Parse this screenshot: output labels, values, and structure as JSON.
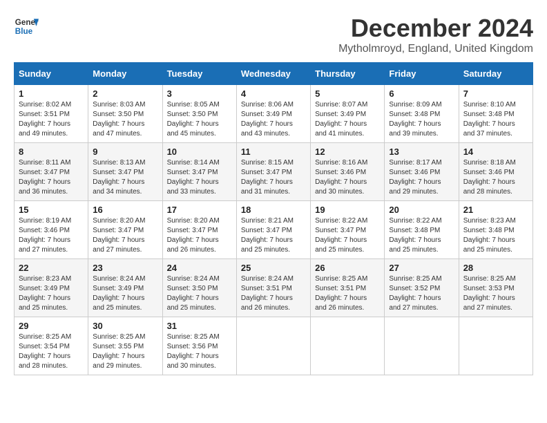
{
  "logo": {
    "line1": "General",
    "line2": "Blue"
  },
  "title": {
    "month": "December 2024",
    "location": "Mytholmroyd, England, United Kingdom"
  },
  "weekdays": [
    "Sunday",
    "Monday",
    "Tuesday",
    "Wednesday",
    "Thursday",
    "Friday",
    "Saturday"
  ],
  "weeks": [
    [
      {
        "day": "1",
        "sunrise": "Sunrise: 8:02 AM",
        "sunset": "Sunset: 3:51 PM",
        "daylight": "Daylight: 7 hours and 49 minutes."
      },
      {
        "day": "2",
        "sunrise": "Sunrise: 8:03 AM",
        "sunset": "Sunset: 3:50 PM",
        "daylight": "Daylight: 7 hours and 47 minutes."
      },
      {
        "day": "3",
        "sunrise": "Sunrise: 8:05 AM",
        "sunset": "Sunset: 3:50 PM",
        "daylight": "Daylight: 7 hours and 45 minutes."
      },
      {
        "day": "4",
        "sunrise": "Sunrise: 8:06 AM",
        "sunset": "Sunset: 3:49 PM",
        "daylight": "Daylight: 7 hours and 43 minutes."
      },
      {
        "day": "5",
        "sunrise": "Sunrise: 8:07 AM",
        "sunset": "Sunset: 3:49 PM",
        "daylight": "Daylight: 7 hours and 41 minutes."
      },
      {
        "day": "6",
        "sunrise": "Sunrise: 8:09 AM",
        "sunset": "Sunset: 3:48 PM",
        "daylight": "Daylight: 7 hours and 39 minutes."
      },
      {
        "day": "7",
        "sunrise": "Sunrise: 8:10 AM",
        "sunset": "Sunset: 3:48 PM",
        "daylight": "Daylight: 7 hours and 37 minutes."
      }
    ],
    [
      {
        "day": "8",
        "sunrise": "Sunrise: 8:11 AM",
        "sunset": "Sunset: 3:47 PM",
        "daylight": "Daylight: 7 hours and 36 minutes."
      },
      {
        "day": "9",
        "sunrise": "Sunrise: 8:13 AM",
        "sunset": "Sunset: 3:47 PM",
        "daylight": "Daylight: 7 hours and 34 minutes."
      },
      {
        "day": "10",
        "sunrise": "Sunrise: 8:14 AM",
        "sunset": "Sunset: 3:47 PM",
        "daylight": "Daylight: 7 hours and 33 minutes."
      },
      {
        "day": "11",
        "sunrise": "Sunrise: 8:15 AM",
        "sunset": "Sunset: 3:47 PM",
        "daylight": "Daylight: 7 hours and 31 minutes."
      },
      {
        "day": "12",
        "sunrise": "Sunrise: 8:16 AM",
        "sunset": "Sunset: 3:46 PM",
        "daylight": "Daylight: 7 hours and 30 minutes."
      },
      {
        "day": "13",
        "sunrise": "Sunrise: 8:17 AM",
        "sunset": "Sunset: 3:46 PM",
        "daylight": "Daylight: 7 hours and 29 minutes."
      },
      {
        "day": "14",
        "sunrise": "Sunrise: 8:18 AM",
        "sunset": "Sunset: 3:46 PM",
        "daylight": "Daylight: 7 hours and 28 minutes."
      }
    ],
    [
      {
        "day": "15",
        "sunrise": "Sunrise: 8:19 AM",
        "sunset": "Sunset: 3:46 PM",
        "daylight": "Daylight: 7 hours and 27 minutes."
      },
      {
        "day": "16",
        "sunrise": "Sunrise: 8:20 AM",
        "sunset": "Sunset: 3:47 PM",
        "daylight": "Daylight: 7 hours and 27 minutes."
      },
      {
        "day": "17",
        "sunrise": "Sunrise: 8:20 AM",
        "sunset": "Sunset: 3:47 PM",
        "daylight": "Daylight: 7 hours and 26 minutes."
      },
      {
        "day": "18",
        "sunrise": "Sunrise: 8:21 AM",
        "sunset": "Sunset: 3:47 PM",
        "daylight": "Daylight: 7 hours and 25 minutes."
      },
      {
        "day": "19",
        "sunrise": "Sunrise: 8:22 AM",
        "sunset": "Sunset: 3:47 PM",
        "daylight": "Daylight: 7 hours and 25 minutes."
      },
      {
        "day": "20",
        "sunrise": "Sunrise: 8:22 AM",
        "sunset": "Sunset: 3:48 PM",
        "daylight": "Daylight: 7 hours and 25 minutes."
      },
      {
        "day": "21",
        "sunrise": "Sunrise: 8:23 AM",
        "sunset": "Sunset: 3:48 PM",
        "daylight": "Daylight: 7 hours and 25 minutes."
      }
    ],
    [
      {
        "day": "22",
        "sunrise": "Sunrise: 8:23 AM",
        "sunset": "Sunset: 3:49 PM",
        "daylight": "Daylight: 7 hours and 25 minutes."
      },
      {
        "day": "23",
        "sunrise": "Sunrise: 8:24 AM",
        "sunset": "Sunset: 3:49 PM",
        "daylight": "Daylight: 7 hours and 25 minutes."
      },
      {
        "day": "24",
        "sunrise": "Sunrise: 8:24 AM",
        "sunset": "Sunset: 3:50 PM",
        "daylight": "Daylight: 7 hours and 25 minutes."
      },
      {
        "day": "25",
        "sunrise": "Sunrise: 8:24 AM",
        "sunset": "Sunset: 3:51 PM",
        "daylight": "Daylight: 7 hours and 26 minutes."
      },
      {
        "day": "26",
        "sunrise": "Sunrise: 8:25 AM",
        "sunset": "Sunset: 3:51 PM",
        "daylight": "Daylight: 7 hours and 26 minutes."
      },
      {
        "day": "27",
        "sunrise": "Sunrise: 8:25 AM",
        "sunset": "Sunset: 3:52 PM",
        "daylight": "Daylight: 7 hours and 27 minutes."
      },
      {
        "day": "28",
        "sunrise": "Sunrise: 8:25 AM",
        "sunset": "Sunset: 3:53 PM",
        "daylight": "Daylight: 7 hours and 27 minutes."
      }
    ],
    [
      {
        "day": "29",
        "sunrise": "Sunrise: 8:25 AM",
        "sunset": "Sunset: 3:54 PM",
        "daylight": "Daylight: 7 hours and 28 minutes."
      },
      {
        "day": "30",
        "sunrise": "Sunrise: 8:25 AM",
        "sunset": "Sunset: 3:55 PM",
        "daylight": "Daylight: 7 hours and 29 minutes."
      },
      {
        "day": "31",
        "sunrise": "Sunrise: 8:25 AM",
        "sunset": "Sunset: 3:56 PM",
        "daylight": "Daylight: 7 hours and 30 minutes."
      },
      null,
      null,
      null,
      null
    ]
  ]
}
